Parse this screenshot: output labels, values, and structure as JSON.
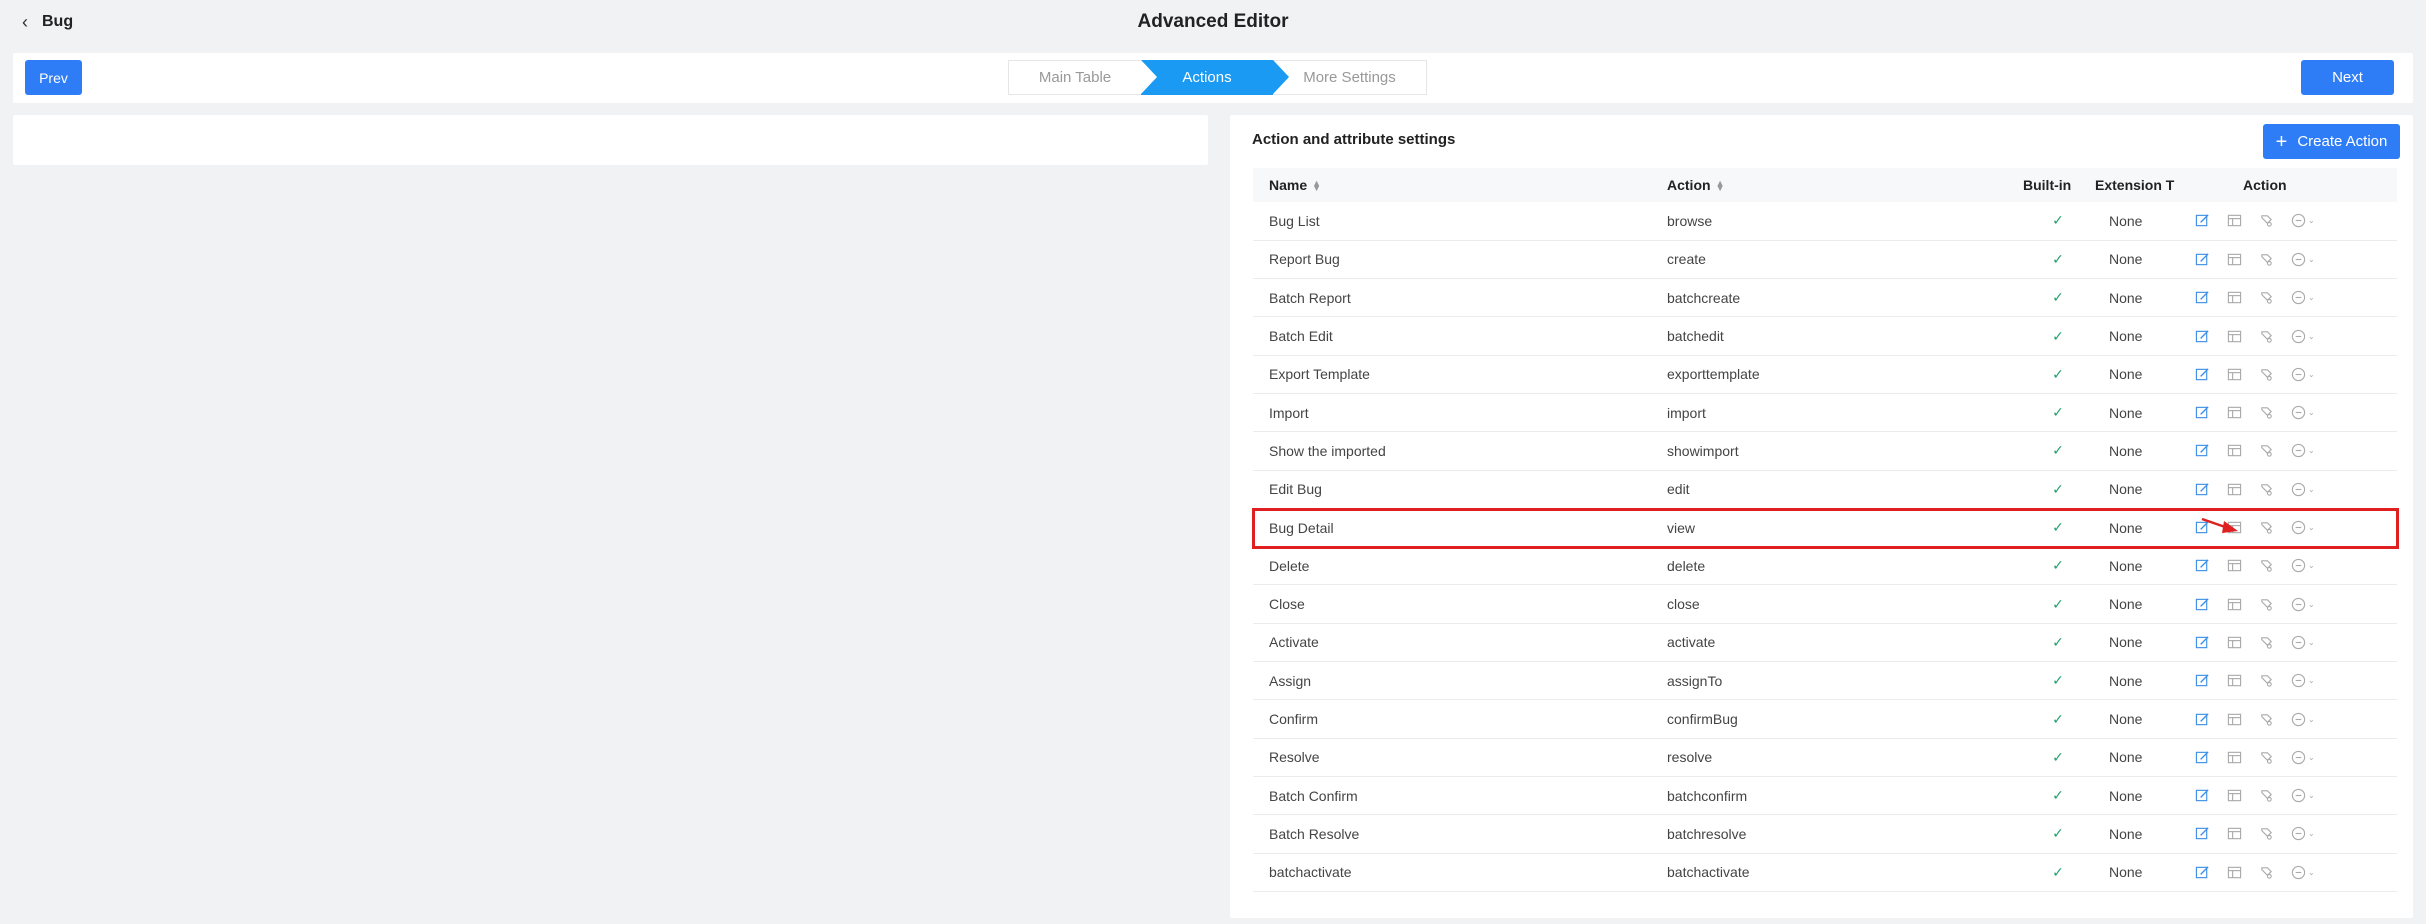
{
  "header": {
    "back_label": "Bug",
    "title": "Advanced Editor"
  },
  "stepbar": {
    "prev_label": "Prev",
    "next_label": "Next",
    "steps": [
      {
        "label": "Main Table",
        "active": false
      },
      {
        "label": "Actions",
        "active": true
      },
      {
        "label": "More Settings",
        "active": false
      }
    ]
  },
  "panel": {
    "title": "Action and attribute settings",
    "create_label": "Create Action",
    "columns": {
      "name": "Name",
      "action": "Action",
      "builtin": "Built-in",
      "extension": "Extension T",
      "ops": "Action"
    },
    "rows": [
      {
        "name": "Bug List",
        "action": "browse",
        "builtin": "✓",
        "extension": "None"
      },
      {
        "name": "Report Bug",
        "action": "create",
        "builtin": "✓",
        "extension": "None"
      },
      {
        "name": "Batch Report",
        "action": "batchcreate",
        "builtin": "✓",
        "extension": "None"
      },
      {
        "name": "Batch Edit",
        "action": "batchedit",
        "builtin": "✓",
        "extension": "None"
      },
      {
        "name": "Export Template",
        "action": "exporttemplate",
        "builtin": "✓",
        "extension": "None"
      },
      {
        "name": "Import",
        "action": "import",
        "builtin": "✓",
        "extension": "None"
      },
      {
        "name": "Show the imported",
        "action": "showimport",
        "builtin": "✓",
        "extension": "None"
      },
      {
        "name": "Edit Bug",
        "action": "edit",
        "builtin": "✓",
        "extension": "None"
      },
      {
        "name": "Bug Detail",
        "action": "view",
        "builtin": "✓",
        "extension": "None"
      },
      {
        "name": "Delete",
        "action": "delete",
        "builtin": "✓",
        "extension": "None"
      },
      {
        "name": "Close",
        "action": "close",
        "builtin": "✓",
        "extension": "None"
      },
      {
        "name": "Activate",
        "action": "activate",
        "builtin": "✓",
        "extension": "None"
      },
      {
        "name": "Assign",
        "action": "assignTo",
        "builtin": "✓",
        "extension": "None"
      },
      {
        "name": "Confirm",
        "action": "confirmBug",
        "builtin": "✓",
        "extension": "None"
      },
      {
        "name": "Resolve",
        "action": "resolve",
        "builtin": "✓",
        "extension": "None"
      },
      {
        "name": "Batch Confirm",
        "action": "batchconfirm",
        "builtin": "✓",
        "extension": "None"
      },
      {
        "name": "Batch Resolve",
        "action": "batchresolve",
        "builtin": "✓",
        "extension": "None"
      },
      {
        "name": "batchactivate",
        "action": "batchactivate",
        "builtin": "✓",
        "extension": "None"
      }
    ],
    "highlighted_row": "Bug Detail"
  },
  "colors": {
    "primary": "#2f7df6",
    "active_step": "#1a9af2",
    "check": "#22a06b",
    "highlight": "#e02020",
    "edit_icon": "#3d8ee6",
    "muted_icon": "#aaaaaa"
  },
  "icons": {
    "back": "chevron-left-icon",
    "create": "plus-icon",
    "row_ops": [
      "edit-icon",
      "layout-icon",
      "design-icon",
      "more-icon"
    ]
  }
}
